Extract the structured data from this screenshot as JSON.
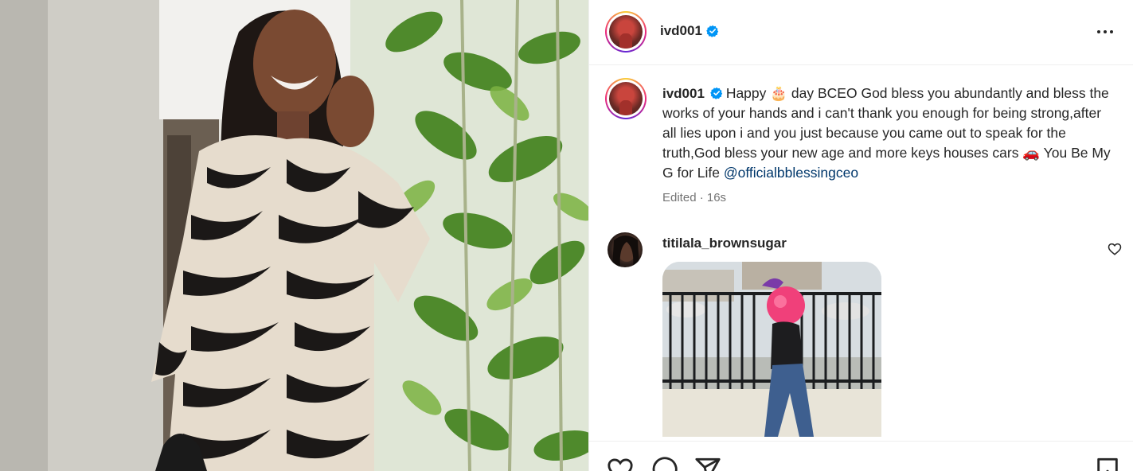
{
  "post": {
    "username": "ivd001",
    "verified": true,
    "more_icon": "more-options-icon",
    "caption": {
      "username": "ivd001",
      "text_part1": "Happy ",
      "emoji": "🎂",
      "text_part2": " day BCEO God bless you abundantly and bless the works of your hands and i can't thank you enough for being strong,after all lies upon i and you just because you came out to speak for the truth,God bless your new age and more keys houses cars ",
      "emoji2": "🚗",
      "text_part3": " You Be My G for Life ",
      "mention": "@officialbblessingceo",
      "meta": "Edited · 16s"
    }
  },
  "comments": [
    {
      "username": "titilala_brownsugar",
      "has_media": true,
      "like_icon": "heart-outline-icon"
    }
  ],
  "actions": {
    "like_icon": "heart-outline-icon",
    "comment_icon": "comment-bubble-icon",
    "share_icon": "paper-plane-icon",
    "save_icon": "bookmark-icon"
  },
  "colors": {
    "verified_blue": "#0095f6",
    "mention_blue": "#00376b",
    "muted_text": "#737373"
  }
}
